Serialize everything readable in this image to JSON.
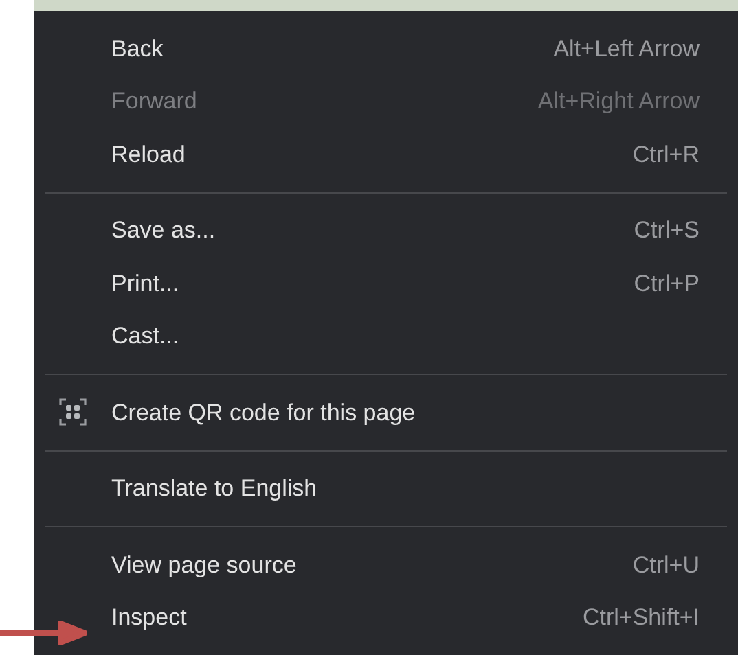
{
  "groups": [
    {
      "items": [
        {
          "kind": "plain",
          "label": "Back",
          "shortcut": "Alt+Left Arrow",
          "disabled": false
        },
        {
          "kind": "plain",
          "label": "Forward",
          "shortcut": "Alt+Right Arrow",
          "disabled": true
        },
        {
          "kind": "plain",
          "label": "Reload",
          "shortcut": "Ctrl+R",
          "disabled": false
        }
      ]
    },
    {
      "items": [
        {
          "kind": "plain",
          "label": "Save as...",
          "shortcut": "Ctrl+S",
          "disabled": false
        },
        {
          "kind": "plain",
          "label": "Print...",
          "shortcut": "Ctrl+P",
          "disabled": false
        },
        {
          "kind": "plain",
          "label": "Cast...",
          "disabled": false
        }
      ]
    },
    {
      "items": [
        {
          "kind": "qr",
          "label": "Create QR code for this page",
          "disabled": false
        }
      ]
    },
    {
      "items": [
        {
          "kind": "plain",
          "label": "Translate to English",
          "disabled": false
        }
      ]
    },
    {
      "items": [
        {
          "kind": "plain",
          "label": "View page source",
          "shortcut": "Ctrl+U",
          "disabled": false
        },
        {
          "kind": "plain",
          "label": "Inspect",
          "shortcut": "Ctrl+Shift+I",
          "disabled": false
        }
      ]
    }
  ]
}
